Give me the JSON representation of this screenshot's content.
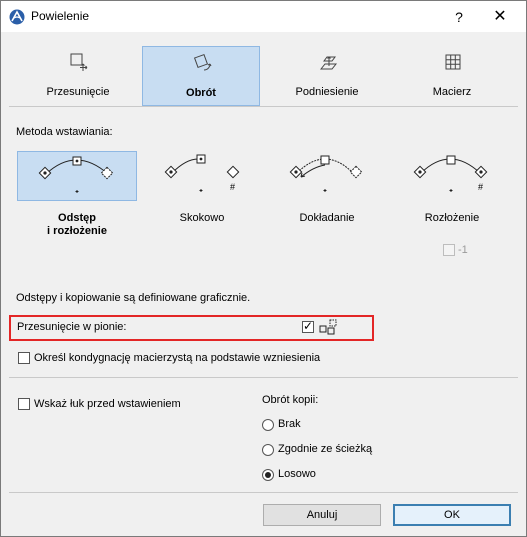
{
  "window": {
    "title": "Powielenie",
    "help": "?",
    "close": "✕"
  },
  "tabs": [
    {
      "label": "Przesunięcie",
      "icon": "move-icon"
    },
    {
      "label": "Obrót",
      "icon": "rotate-icon",
      "selected": true
    },
    {
      "label": "Podniesienie",
      "icon": "elevate-icon"
    },
    {
      "label": "Macierz",
      "icon": "matrix-icon"
    }
  ],
  "method": {
    "heading": "Metoda wstawiania:",
    "options": [
      {
        "label_line1": "Odstęp",
        "label_line2": "i rozłożenie",
        "selected": true
      },
      {
        "label_line1": "Skokowo",
        "label_line2": ""
      },
      {
        "label_line1": "Dokładanie",
        "label_line2": ""
      },
      {
        "label_line1": "Rozłożenie",
        "label_line2": ""
      }
    ],
    "minus_one_label": "-1"
  },
  "info_text": "Odstępy i kopiowanie są definiowane graficznie.",
  "vertical_offset": {
    "label": "Przesunięcie w pionie:",
    "checked": true
  },
  "floor_option": {
    "label": "Określ kondygnację macierzystą na podstawie wzniesienia",
    "checked": false
  },
  "show_arc": {
    "label": "Wskaż łuk przed wstawieniem",
    "checked": false
  },
  "copy_rotation": {
    "heading": "Obrót kopii:",
    "options": [
      {
        "label": "Brak",
        "selected": false
      },
      {
        "label": "Zgodnie ze ścieżką",
        "selected": false
      },
      {
        "label": "Losowo",
        "selected": true
      }
    ]
  },
  "buttons": {
    "cancel": "Anuluj",
    "ok": "OK"
  },
  "colors": {
    "selection": "#c8ddf2",
    "highlight_box": "#e32626"
  }
}
